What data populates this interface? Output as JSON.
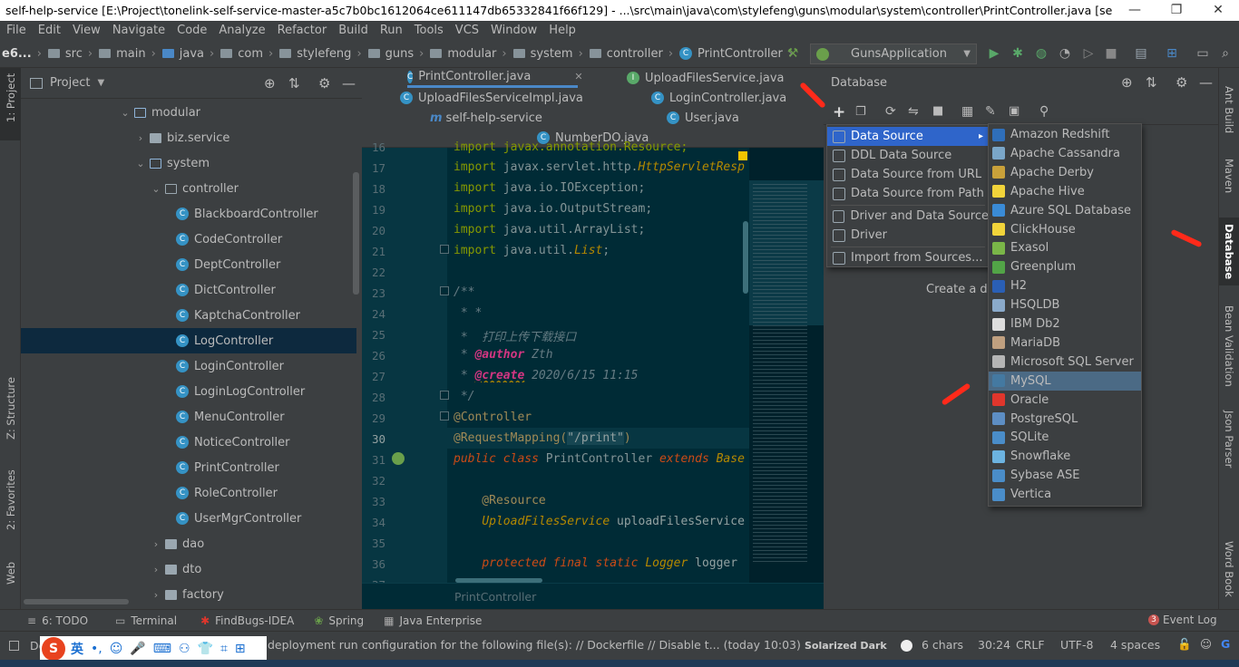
{
  "window": {
    "title": "self-help-service [E:\\Project\\tonelink-self-service-master-a5c7b0bc1612064ce611147db65332841f66f129] - ...\\src\\main\\java\\com\\stylefeng\\guns\\modular\\system\\controller\\PrintController.java [self-help-ser...",
    "minimize": "—",
    "maximize": "❐",
    "close": "✕"
  },
  "menu": [
    "File",
    "Edit",
    "View",
    "Navigate",
    "Code",
    "Analyze",
    "Refactor",
    "Build",
    "Run",
    "Tools",
    "VCS",
    "Window",
    "Help"
  ],
  "breadcrumb": {
    "root": "e6...",
    "items": [
      "src",
      "main",
      "java",
      "com",
      "stylefeng",
      "guns",
      "modular",
      "system",
      "controller",
      "PrintController"
    ],
    "run_config": "GunsApplication"
  },
  "left_strip": {
    "project": "1: Project",
    "structure": "Z: Structure",
    "favorites": "2: Favorites",
    "web": "Web"
  },
  "project": {
    "title": "Project",
    "tree": [
      {
        "label": "modular",
        "type": "folder",
        "depth": 0,
        "expanded": true
      },
      {
        "label": "biz.service",
        "type": "folder",
        "depth": 1,
        "expanded": false
      },
      {
        "label": "system",
        "type": "folder",
        "depth": 1,
        "expanded": true
      },
      {
        "label": "controller",
        "type": "folder",
        "depth": 2,
        "expanded": true
      },
      {
        "label": "BlackboardController",
        "type": "class",
        "depth": 3
      },
      {
        "label": "CodeController",
        "type": "class",
        "depth": 3
      },
      {
        "label": "DeptController",
        "type": "class",
        "depth": 3
      },
      {
        "label": "DictController",
        "type": "class",
        "depth": 3
      },
      {
        "label": "KaptchaController",
        "type": "class",
        "depth": 3
      },
      {
        "label": "LogController",
        "type": "class",
        "depth": 3,
        "selected": true
      },
      {
        "label": "LoginController",
        "type": "class",
        "depth": 3
      },
      {
        "label": "LoginLogController",
        "type": "class",
        "depth": 3
      },
      {
        "label": "MenuController",
        "type": "class",
        "depth": 3
      },
      {
        "label": "NoticeController",
        "type": "class",
        "depth": 3
      },
      {
        "label": "PrintController",
        "type": "class",
        "depth": 3
      },
      {
        "label": "RoleController",
        "type": "class",
        "depth": 3
      },
      {
        "label": "UserMgrController",
        "type": "class",
        "depth": 3
      },
      {
        "label": "dao",
        "type": "folder",
        "depth": 2,
        "expanded": false
      },
      {
        "label": "dto",
        "type": "folder",
        "depth": 2,
        "expanded": false
      },
      {
        "label": "factory",
        "type": "folder",
        "depth": 2,
        "expanded": false
      }
    ]
  },
  "editor": {
    "tabs": [
      "PrintController.java",
      "UploadFilesService.java",
      "UploadFilesServiceImpl.java",
      "LoginController.java",
      "self-help-service",
      "User.java",
      "NumberDO.java"
    ],
    "close_glyph": "✕",
    "line_numbers": [
      "16",
      "17",
      "18",
      "19",
      "20",
      "21",
      "22",
      "23",
      "24",
      "25",
      "26",
      "27",
      "28",
      "29",
      "30",
      "31",
      "32",
      "33",
      "34",
      "35",
      "36",
      "37"
    ],
    "lines": {
      "l16": "import javax.annotation.Resource;",
      "l17a": "import ",
      "l17b": "javax.servlet.http.",
      "l17c": "HttpServletResp",
      "l18a": "import ",
      "l18b": "java.io.IOException;",
      "l19a": "import ",
      "l19b": "java.io.OutputStream;",
      "l20a": "import ",
      "l20b": "java.util.ArrayList;",
      "l21a": "import ",
      "l21b": "java.util.",
      "l21c": "List",
      "l21d": ";",
      "l23": "/**",
      "l24": " * *",
      "l25": " *  打印上传下载接口",
      "l26a": " * ",
      "l26b": "@author",
      "l26c": " Zth",
      "l27a": " * ",
      "l27b": "@create",
      "l27c": " 2020/6/15 11:15",
      "l28": " */",
      "l29": "@Controller",
      "l30a": "@RequestMapping(",
      "l30b": "\"/print\"",
      "l30c": ")",
      "l31a": "public class ",
      "l31b": "PrintController ",
      "l31c": "extends ",
      "l31d": "Base",
      "l33": "    @Resource",
      "l34a": "    ",
      "l34b": "UploadFilesService",
      "l34c": " uploadFilesService",
      "l36a": "    ",
      "l36b": "protected final static ",
      "l36c": "Logger",
      "l36d": " logger"
    },
    "footer_crumb": "PrintController"
  },
  "database": {
    "title": "Database",
    "empty_hint": "Create a da",
    "add_menu": [
      {
        "label": "Data Source",
        "submenu": true,
        "highlighted": true
      },
      {
        "label": "DDL Data Source"
      },
      {
        "label": "Data Source from URL"
      },
      {
        "label": "Data Source from Path"
      },
      {
        "label": "Driver and Data Source"
      },
      {
        "label": "Driver"
      },
      {
        "label": "Import from Sources..."
      }
    ],
    "submenu_arrow": "▸",
    "drivers": [
      {
        "label": "Amazon Redshift",
        "color": "#2f6fba"
      },
      {
        "label": "Apache Cassandra",
        "color": "#7aa6c8"
      },
      {
        "label": "Apache Derby",
        "color": "#c9a13a"
      },
      {
        "label": "Apache Hive",
        "color": "#f2d43a"
      },
      {
        "label": "Azure SQL Database",
        "color": "#3a8bd6"
      },
      {
        "label": "ClickHouse",
        "color": "#f2d43a"
      },
      {
        "label": "Exasol",
        "color": "#7ab648"
      },
      {
        "label": "Greenplum",
        "color": "#52a447"
      },
      {
        "label": "H2",
        "color": "#2a5fb5"
      },
      {
        "label": "HSQLDB",
        "color": "#8aaacb"
      },
      {
        "label": "IBM Db2",
        "color": "#dddddd"
      },
      {
        "label": "MariaDB",
        "color": "#c0a080"
      },
      {
        "label": "Microsoft SQL Server",
        "color": "#b5b5b5"
      },
      {
        "label": "MySQL",
        "color": "#4479a1",
        "highlighted": true
      },
      {
        "label": "Oracle",
        "color": "#e0362c"
      },
      {
        "label": "PostgreSQL",
        "color": "#5d8ec4"
      },
      {
        "label": "SQLite",
        "color": "#4a8dc9"
      },
      {
        "label": "Snowflake",
        "color": "#6cb3e0"
      },
      {
        "label": "Sybase ASE",
        "color": "#4a8dc9"
      },
      {
        "label": "Vertica",
        "color": "#4a8dc9"
      }
    ]
  },
  "right_strip": [
    "Ant Build",
    "Maven",
    "Database",
    "Bean Validation",
    "Json Parser",
    "Word Book"
  ],
  "bottom_tools": [
    "6: TODO",
    "Terminal",
    "FindBugs-IDEA",
    "Spring",
    "Java Enterprise"
  ],
  "event_log": {
    "count": "3",
    "label": "Event Log"
  },
  "status": {
    "message_prefix": "Do",
    "message": "deployment run configuration for the following file(s): // Dockerfile // Disable t... (today 10:03)",
    "theme": "Solarized Dark",
    "chars": "6 chars",
    "position": "30:24",
    "line_sep": "CRLF",
    "encoding": "UTF-8",
    "indent": "4 spaces"
  },
  "ime": {
    "logo": "S",
    "lang": "英"
  },
  "colors": {
    "accent": "#2f65ca",
    "background": "#3c3f41",
    "editor_bg": "#002b36",
    "arrow": "#ff2a1a"
  }
}
